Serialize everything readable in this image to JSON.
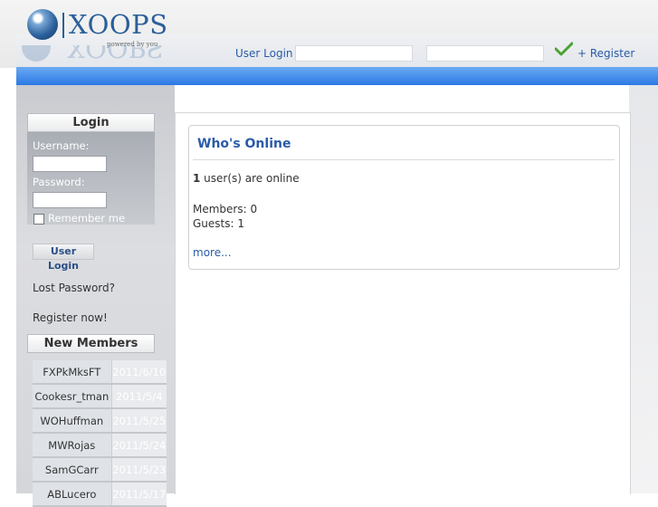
{
  "header": {
    "logo_text": "XOOPS",
    "logo_tagline": "powered by you",
    "user_login_label": "User Login",
    "register_label": "+ Register"
  },
  "login_block": {
    "title": "Login",
    "username_label": "Username:",
    "password_label": "Password:",
    "remember_label": "Remember me",
    "login_button": "User Login",
    "lost_password": "Lost Password?",
    "register_now": "Register now!"
  },
  "new_members": {
    "title": "New Members",
    "rows": [
      {
        "name": "FXPkMksFT",
        "date": "2011/6/10"
      },
      {
        "name": "Cookesr_tman",
        "date": "2011/5/4"
      },
      {
        "name": "WOHuffman",
        "date": "2011/5/25"
      },
      {
        "name": "MWRojas",
        "date": "2011/5/24"
      },
      {
        "name": "SamGCarr",
        "date": "2011/5/23"
      },
      {
        "name": "ABLucero",
        "date": "2011/5/17"
      }
    ]
  },
  "whos_online": {
    "title": "Who's Online",
    "count": "1",
    "count_suffix": " user(s) are online",
    "members": "Members: 0",
    "guests": "Guests: 1",
    "more": "more..."
  },
  "colors": {
    "accent_blue": "#2a5ba8",
    "bar_blue": "#2b79e4"
  },
  "icons": {
    "logo": "xoops-globe-icon",
    "submit": "checkmark-icon"
  }
}
